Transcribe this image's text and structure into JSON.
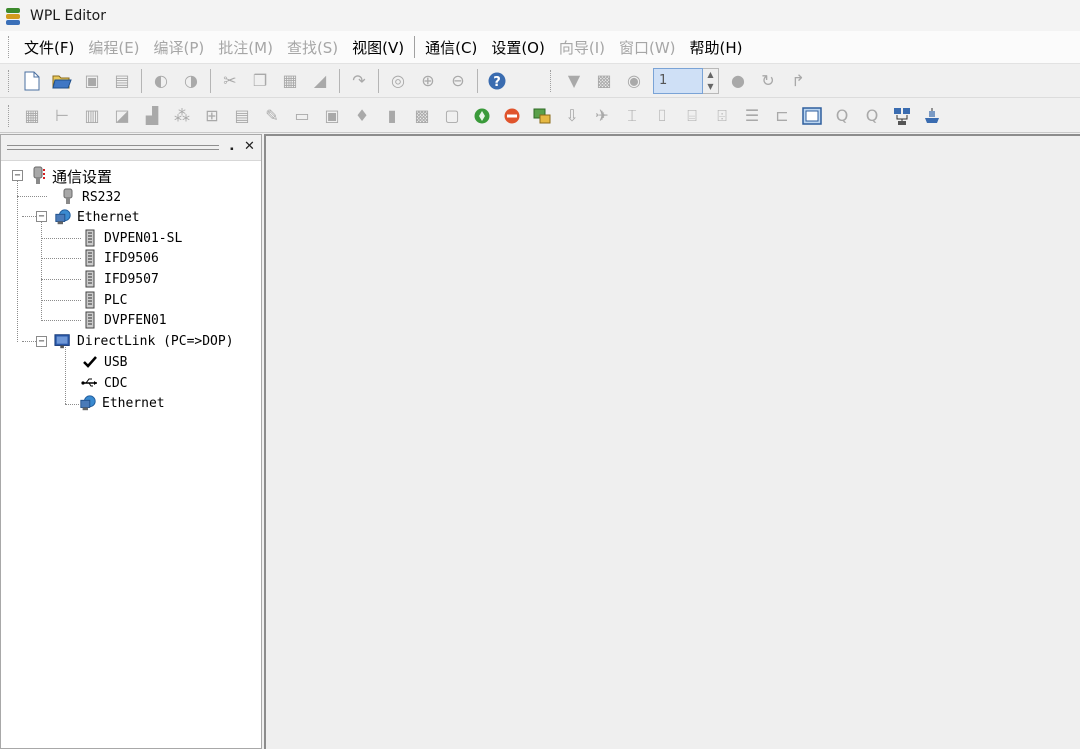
{
  "window": {
    "title": "WPL Editor"
  },
  "menu": [
    {
      "label": "文件(F)",
      "enabled": true
    },
    {
      "label": "编程(E)",
      "enabled": false
    },
    {
      "label": "编译(P)",
      "enabled": false
    },
    {
      "label": "批注(M)",
      "enabled": false
    },
    {
      "label": "查找(S)",
      "enabled": false
    },
    {
      "label": "视图(V)",
      "enabled": true
    },
    {
      "label": "通信(C)",
      "enabled": true
    },
    {
      "label": "设置(O)",
      "enabled": true
    },
    {
      "label": "向导(I)",
      "enabled": false
    },
    {
      "label": "窗口(W)",
      "enabled": false
    },
    {
      "label": "帮助(H)",
      "enabled": true
    }
  ],
  "toolbar": {
    "station_value": "1"
  },
  "tree": {
    "root": "通信设置",
    "rs232": "RS232",
    "ethernet": "Ethernet",
    "ethernet_children": [
      "DVPEN01-SL",
      "IFD9506",
      "IFD9507",
      "PLC",
      "DVPFEN01"
    ],
    "directlink": "DirectLink (PC=>DOP)",
    "directlink_children": [
      "USB",
      "CDC",
      "Ethernet"
    ]
  },
  "colors": {
    "accent": "#2f5f9e",
    "disabled_text": "#a6a6a6"
  }
}
